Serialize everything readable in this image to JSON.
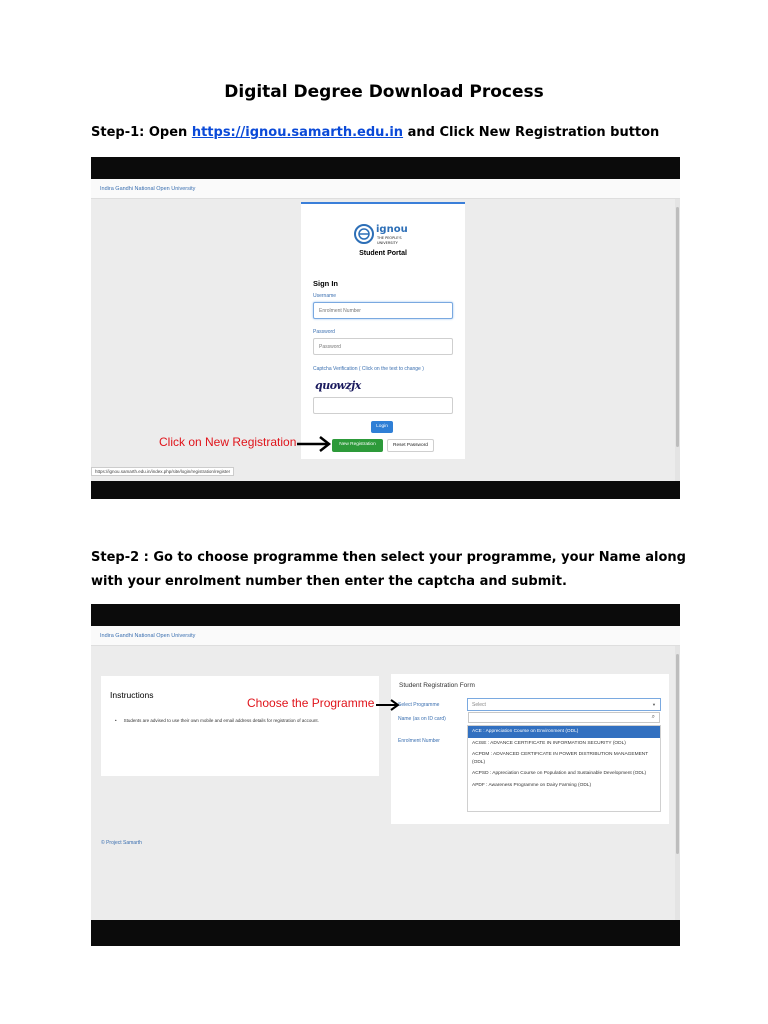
{
  "title": "Digital Degree Download Process",
  "step1": {
    "prefix": "Step-1: Open ",
    "link": "https://ignou.samarth.edu.in",
    "suffix": " and Click New Registration button"
  },
  "step2": {
    "text": "Step-2 : Go to choose programme then select your programme, your Name along with your enrolment number then enter the captcha and submit."
  },
  "screenshot1": {
    "site_name": "Indira Gandhi National Open University",
    "logo_text": "ignou",
    "logo_sub1": "THE PEOPLE'S",
    "logo_sub2": "UNIVERSITY",
    "portal_title": "Student Portal",
    "signin_title": "Sign In",
    "username_label": "Username",
    "username_placeholder": "Enrolment Number",
    "password_label": "Password",
    "password_placeholder": "Password",
    "captcha_label": "Captcha Verification ( Click on the text to change )",
    "captcha_text": "quowzjx",
    "login_button": "Login",
    "new_registration_button": "New Registration",
    "reset_password_button": "Reset Password",
    "status_url": "https://ignou.samarth.edu.in/index.php/site/login/registration/register",
    "annotation": "Click on New Registration"
  },
  "screenshot2": {
    "site_name": "Indira Gandhi National Open University",
    "instructions_title": "Instructions",
    "instruction_item": "Students are advised to use their own mobile and email address details for registration of account.",
    "form_title": "Student Registration Form",
    "select_programme_label": "Select Programme",
    "name_label": "Name (as on ID card)",
    "enrolment_label": "Enrolment Number",
    "select_placeholder": "Select",
    "options": [
      "ACE : Appreciation Course on Environment (ODL)",
      "ACISE : ADVANCE CERTIFICATE IN INFORMATION SECURITY (ODL)",
      "ACPDM : ADVANCED CERTIFICATE IN POWER DISTRIBUTION MANAGEMENT (ODL)",
      "ACPSD : Appreciation Course on Population and Sustainable Development (ODL)",
      "APDF : Awareness Programme on Dairy Farming (ODL)"
    ],
    "footer": "© Project Samarth",
    "annotation": "Choose the Programme"
  },
  "colors": {
    "link": "#0b4ad8",
    "annotation": "#e0141b",
    "primary_button": "#2f7fd6",
    "success_button": "#2d9a3a"
  }
}
